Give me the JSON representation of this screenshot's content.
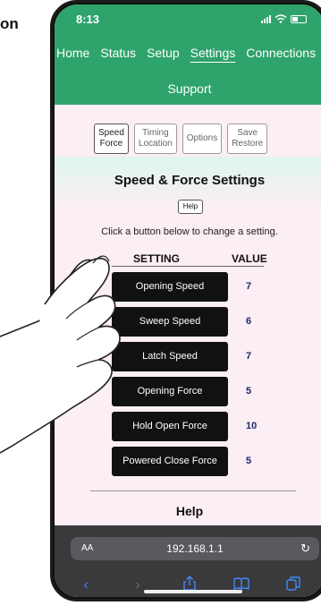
{
  "page": {
    "corner_text": "on"
  },
  "status": {
    "time": "8:13"
  },
  "nav": {
    "items": [
      "Home",
      "Status",
      "Setup",
      "Settings",
      "Connections"
    ],
    "active": "Settings",
    "support": "Support"
  },
  "tabs": [
    {
      "line1": "Speed",
      "line2": "Force",
      "active": true
    },
    {
      "line1": "Timing",
      "line2": "Location",
      "active": false
    },
    {
      "line1": "Options",
      "line2": "",
      "active": false
    },
    {
      "line1": "Save",
      "line2": "Restore",
      "active": false
    }
  ],
  "content": {
    "title": "Speed & Force Settings",
    "help_button": "Help",
    "instruction": "Click a button below to change a setting.",
    "col_setting": "SETTING",
    "col_value": "VALUE",
    "rows": [
      {
        "label": "Opening Speed",
        "value": "7"
      },
      {
        "label": "Sweep Speed",
        "value": "6"
      },
      {
        "label": "Latch Speed",
        "value": "7"
      },
      {
        "label": "Opening Force",
        "value": "5"
      },
      {
        "label": "Hold Open Force",
        "value": "10"
      },
      {
        "label": "Powered Close Force",
        "value": "5"
      }
    ],
    "help_heading": "Help"
  },
  "browser": {
    "aa_label": "AA",
    "url": "192.168.1.1",
    "reload_icon": "reload-icon",
    "tools": [
      "back-icon",
      "forward-icon",
      "share-icon",
      "bookmarks-icon",
      "tabs-icon"
    ]
  },
  "colors": {
    "accent": "#2fa36c",
    "value": "#1e2a6a",
    "button": "#111111"
  }
}
